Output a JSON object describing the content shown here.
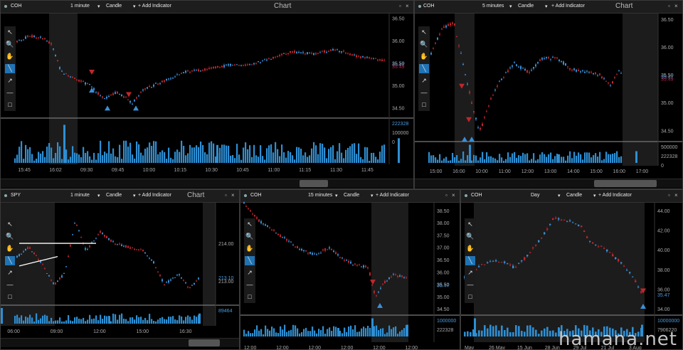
{
  "panels": [
    {
      "symbol": "COH",
      "interval": "1 minute",
      "type": "Candle",
      "add": "+ Add Indicator",
      "title": "Chart",
      "yticks": [
        "36.50",
        "36.00",
        "35.50",
        "35.00",
        "34.50"
      ],
      "price_labels": [
        "35.47",
        "35.49"
      ],
      "vol_labels": [
        "222328",
        "100000",
        "0"
      ],
      "xticks": [
        "15:45",
        "16:02",
        "09:30",
        "09:45",
        "10:00",
        "10:15",
        "10:30",
        "10:45",
        "11:00",
        "11:15",
        "11:30",
        "11:45"
      ]
    },
    {
      "symbol": "COH",
      "interval": "5 minutes",
      "type": "Candle",
      "add": "+ Add Indicator",
      "title": "Chart",
      "yticks": [
        "36.50",
        "36.00",
        "35.50",
        "35.00",
        "34.50"
      ],
      "price_labels": [
        "35.47",
        "35.49"
      ],
      "vol_labels": [
        "500000",
        "222328",
        "0"
      ],
      "xticks": [
        "15:00",
        "16:00",
        "10:00",
        "11:00",
        "12:00",
        "13:00",
        "14:00",
        "15:00",
        "16:00",
        "17:00"
      ]
    },
    {
      "symbol": "SPY",
      "interval": "1 minute",
      "type": "Candle",
      "add": "+ Add Indicator",
      "title": "Chart",
      "yticks": [
        "214.00",
        "213.00"
      ],
      "price_labels": [
        "213.10"
      ],
      "vol_labels": [
        "89464"
      ],
      "xticks": [
        "06:00",
        "09:00",
        "12:00",
        "15:00",
        "16:30"
      ]
    },
    {
      "symbol": "COH",
      "interval": "15 minutes",
      "type": "Candle",
      "add": "+ Add Indicator",
      "title": "",
      "yticks": [
        "38.50",
        "38.00",
        "37.50",
        "37.00",
        "36.50",
        "36.00",
        "35.50",
        "35.00",
        "34.50"
      ],
      "price_labels": [
        "35.47"
      ],
      "vol_labels": [
        "1000000",
        "222328"
      ],
      "xticks": [
        "12:00",
        "12:00",
        "12:00",
        "12:00",
        "12:00",
        "12:00"
      ]
    },
    {
      "symbol": "COH",
      "interval": "Day",
      "type": "Candle",
      "add": "+ Add Indicator",
      "title": "",
      "yticks": [
        "44.00",
        "42.00",
        "40.00",
        "38.00",
        "36.00",
        "34.00"
      ],
      "price_labels": [
        "35.47"
      ],
      "vol_labels": [
        "10000000",
        "7906220"
      ],
      "xticks": [
        "May",
        "26 May",
        "15 Jun",
        "28 Jun",
        "29 Jul",
        "21 Jul",
        "3 Aug"
      ]
    }
  ],
  "watermark": "hamana.net",
  "colors": {
    "up": "#3b8fd6",
    "down": "#c0272d",
    "bg": "#000000",
    "volume": "#2e8fd4",
    "session": "#333333"
  },
  "tools": [
    "pointer-icon",
    "zoom-icon",
    "hand-icon",
    "line-icon",
    "arrow-icon",
    "hline-icon",
    "rect-icon"
  ],
  "tool_glyphs": [
    "↖",
    "🔍",
    "✋",
    "╲",
    "↗",
    "—",
    "□"
  ],
  "chart_data": [
    {
      "type": "candlestick",
      "title": "COH 1 minute",
      "x_range_labels": [
        "15:45",
        "11:45"
      ],
      "ylim": [
        34.3,
        36.6
      ],
      "last_price": 35.47
    },
    {
      "type": "candlestick",
      "title": "COH 5 minutes",
      "x_range_labels": [
        "15:00",
        "17:00"
      ],
      "ylim": [
        34.3,
        36.6
      ],
      "last_price": 35.47
    },
    {
      "type": "candlestick",
      "title": "SPY 1 minute",
      "x_range_labels": [
        "06:00",
        "16:30"
      ],
      "ylim": [
        212.4,
        215.0
      ],
      "last_price": 213.1
    },
    {
      "type": "candlestick",
      "title": "COH 15 minutes",
      "x_range_labels": [
        "12:00",
        "12:00"
      ],
      "ylim": [
        34.3,
        38.7
      ],
      "last_price": 35.47
    },
    {
      "type": "candlestick",
      "title": "COH Day",
      "x_range_labels": [
        "May",
        "3 Aug"
      ],
      "ylim": [
        33.5,
        44.5
      ],
      "last_price": 35.47
    }
  ]
}
